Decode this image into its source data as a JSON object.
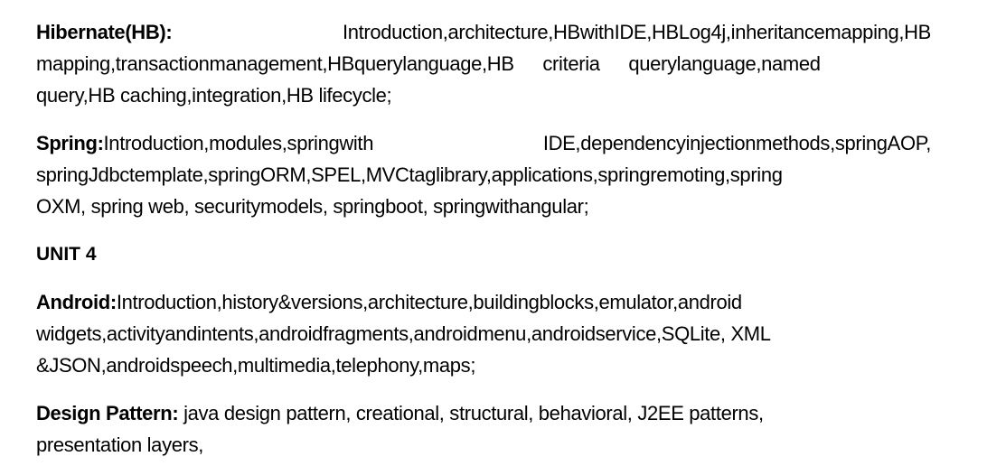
{
  "hibernate": {
    "term": "Hibernate(HB):",
    "text_line1": "Introduction,architecture,HBwithIDE,HBLog4j,inheritancemapping,HB",
    "text_line2": "mapping,transactionmanagement,HBquerylanguage,HB criteria querylanguage,named",
    "text_line3": "query,HB caching,integration,HB lifecycle;"
  },
  "spring": {
    "term": "Spring:",
    "text_line1a": "Introduction,modules,springwith",
    "text_line1b": "IDE,dependencyinjectionmethods,springAOP,",
    "text_line2": "springJdbctemplate,springORM,SPEL,MVCtaglibrary,applications,springremoting,spring",
    "text_line3": "OXM, spring web, securitymodels, springboot, springwithangular;"
  },
  "unit_heading": "UNIT 4",
  "android": {
    "term": "Android:",
    "text_line1": "Introduction,history&versions,architecture,buildingblocks,emulator,android",
    "text_line2": "widgets,activityandintents,androidfragments,androidmenu,androidservice,SQLite, XML",
    "text_line3": "&JSON,androidspeech,multimedia,telephony,maps;"
  },
  "design_pattern": {
    "term": "Design Pattern:",
    "text_line1": " java design pattern, creational, structural, behavioral, J2EE patterns,",
    "text_line2": "presentation layers,"
  }
}
